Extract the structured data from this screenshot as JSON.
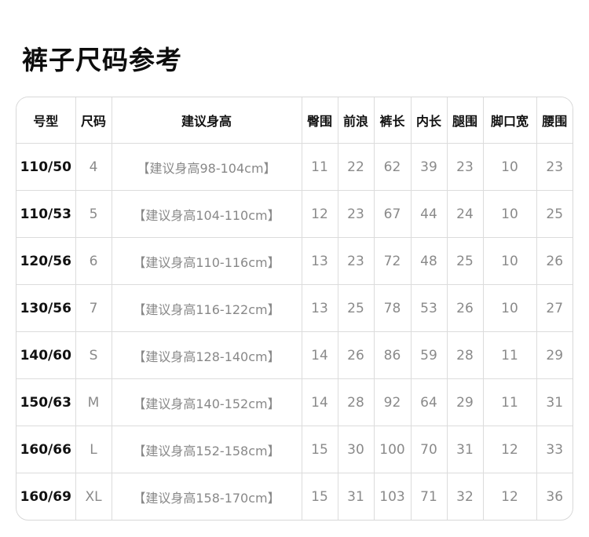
{
  "page": {
    "title": "裤子尺码参考"
  },
  "table": {
    "headers": [
      "号型",
      "尺码",
      "建议身高",
      "臀围",
      "前浪",
      "裤长",
      "内长",
      "腿围",
      "脚口宽",
      "腰围"
    ],
    "rows": [
      [
        "110/50",
        "4",
        "【建议身高98-104cm】",
        "11",
        "22",
        "62",
        "39",
        "23",
        "10",
        "23"
      ],
      [
        "110/53",
        "5",
        "【建议身高104-110cm】",
        "12",
        "23",
        "67",
        "44",
        "24",
        "10",
        "25"
      ],
      [
        "120/56",
        "6",
        "【建议身高110-116cm】",
        "13",
        "23",
        "72",
        "48",
        "25",
        "10",
        "26"
      ],
      [
        "130/56",
        "7",
        "【建议身高116-122cm】",
        "13",
        "25",
        "78",
        "53",
        "26",
        "10",
        "27"
      ],
      [
        "140/60",
        "S",
        "【建议身高128-140cm】",
        "14",
        "26",
        "86",
        "59",
        "28",
        "11",
        "29"
      ],
      [
        "150/63",
        "M",
        "【建议身高140-152cm】",
        "14",
        "28",
        "92",
        "64",
        "29",
        "11",
        "31"
      ],
      [
        "160/66",
        "L",
        "【建议身高152-158cm】",
        "15",
        "30",
        "100",
        "70",
        "31",
        "12",
        "33"
      ],
      [
        "160/69",
        "XL",
        "【建议身高158-170cm】",
        "15",
        "31",
        "103",
        "71",
        "32",
        "12",
        "36"
      ]
    ]
  }
}
